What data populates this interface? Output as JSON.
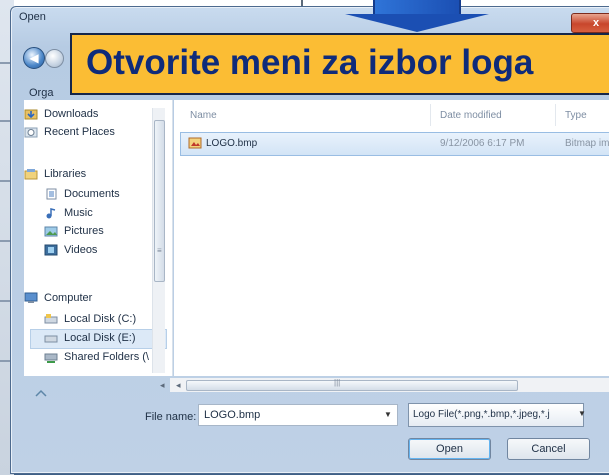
{
  "window": {
    "title": "Open",
    "close_label": "x"
  },
  "toolbar": {
    "organize_label": "Orga"
  },
  "banner": {
    "text": "Otvorite meni za izbor loga"
  },
  "sidebar": {
    "items": [
      {
        "label": "Downloads",
        "icon": "downloads-icon"
      },
      {
        "label": "Recent Places",
        "icon": "recent-places-icon"
      },
      {
        "label": "Libraries",
        "icon": "libraries-icon"
      },
      {
        "label": "Documents",
        "icon": "documents-icon"
      },
      {
        "label": "Music",
        "icon": "music-icon"
      },
      {
        "label": "Pictures",
        "icon": "pictures-icon"
      },
      {
        "label": "Videos",
        "icon": "videos-icon"
      },
      {
        "label": "Computer",
        "icon": "computer-icon"
      },
      {
        "label": "Local Disk (C:)",
        "icon": "local-disk-icon"
      },
      {
        "label": "Local Disk (E:)",
        "icon": "local-disk-icon"
      },
      {
        "label": "Shared Folders (\\",
        "icon": "shared-folders-icon"
      }
    ]
  },
  "columns": {
    "name": "Name",
    "date_modified": "Date modified",
    "type": "Type"
  },
  "files": [
    {
      "name": "LOGO.bmp",
      "date": "9/12/2006 6:17 PM",
      "type": "Bitmap im"
    }
  ],
  "footer": {
    "file_name_label": "File name:",
    "file_name_value": "LOGO.bmp",
    "file_type_value": "Logo File(*.png,*.bmp,*.jpeg,*.j",
    "open_label": "Open",
    "cancel_label": "Cancel"
  }
}
